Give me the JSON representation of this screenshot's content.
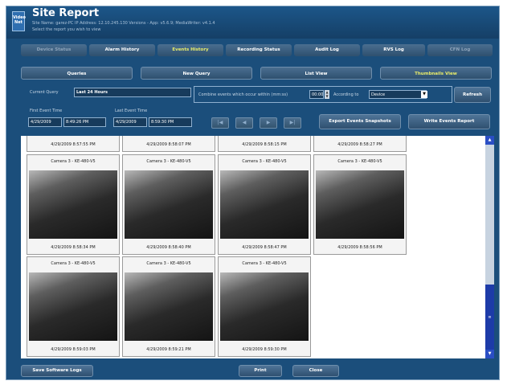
{
  "header": {
    "logo_text": "Video Net",
    "title": "Site Report",
    "site_info": "Site Name: garez-PC   IP Address: 12.10.245.130 Versions - App: v5.6.9; MediaWriter: v4.1.4",
    "instruction": "Select the report you wish to view"
  },
  "tabs": [
    {
      "label": "Device Status",
      "state": "disabled"
    },
    {
      "label": "Alarm History",
      "state": "normal"
    },
    {
      "label": "Events History",
      "state": "active"
    },
    {
      "label": "Recording Status",
      "state": "normal"
    },
    {
      "label": "Audit Log",
      "state": "normal"
    },
    {
      "label": "RVS Log",
      "state": "normal"
    },
    {
      "label": "CFN Log",
      "state": "disabled"
    }
  ],
  "views": [
    {
      "label": "Queries",
      "state": "normal"
    },
    {
      "label": "New Query",
      "state": "normal"
    },
    {
      "label": "List View",
      "state": "normal"
    },
    {
      "label": "Thumbnails View",
      "state": "active"
    }
  ],
  "query": {
    "label": "Current Query",
    "value": "Last 24 Hours",
    "combine_label": "Combine events which occur within (mm:ss)",
    "combine_value": "00:00",
    "according_label": "According to",
    "according_value": "Device",
    "refresh_label": "Refresh",
    "first_event_label": "First Event Time",
    "first_event_date": "4/29/2009",
    "first_event_time": "8:49:26 PM",
    "last_event_label": "Last Event Time",
    "last_event_date": "4/29/2009",
    "last_event_time": "8:59:30 PM",
    "export_label": "Export Events Snapshots",
    "write_label": "Write Events Report"
  },
  "nav": {
    "first": "|◀",
    "prev": "◀",
    "next": "▶",
    "last": "▶|"
  },
  "top_row": [
    "4/29/2009 8:57:55 PM",
    "4/29/2009 8:58:07 PM",
    "4/29/2009 8:58:15 PM",
    "4/29/2009 8:58:27 PM"
  ],
  "thumbnails": [
    {
      "camera": "Camera 3 - KE-480-V5",
      "time": "4/29/2009 8:58:34 PM"
    },
    {
      "camera": "Camera 3 - KE-480-V5",
      "time": "4/29/2009 8:58:40 PM"
    },
    {
      "camera": "Camera 3 - KE-480-V5",
      "time": "4/29/2009 8:58:47 PM"
    },
    {
      "camera": "Camera 3 - KE-480-V5",
      "time": "4/29/2009 8:58:56 PM"
    },
    {
      "camera": "Camera 3 - KE-480-V5",
      "time": "4/29/2009 8:59:03 PM"
    },
    {
      "camera": "Camera 3 - KE-480-V5",
      "time": "4/29/2009 8:59:21 PM"
    },
    {
      "camera": "Camera 3 - KE-480-V5",
      "time": "4/29/2009 8:59:30 PM"
    }
  ],
  "footer": {
    "save_logs": "Save Software Logs",
    "print": "Print",
    "close": "Close"
  },
  "colors": {
    "background": "#1b4e7b",
    "active_text": "#e9ec6a",
    "scroll_thumb": "#1d3ba8"
  }
}
